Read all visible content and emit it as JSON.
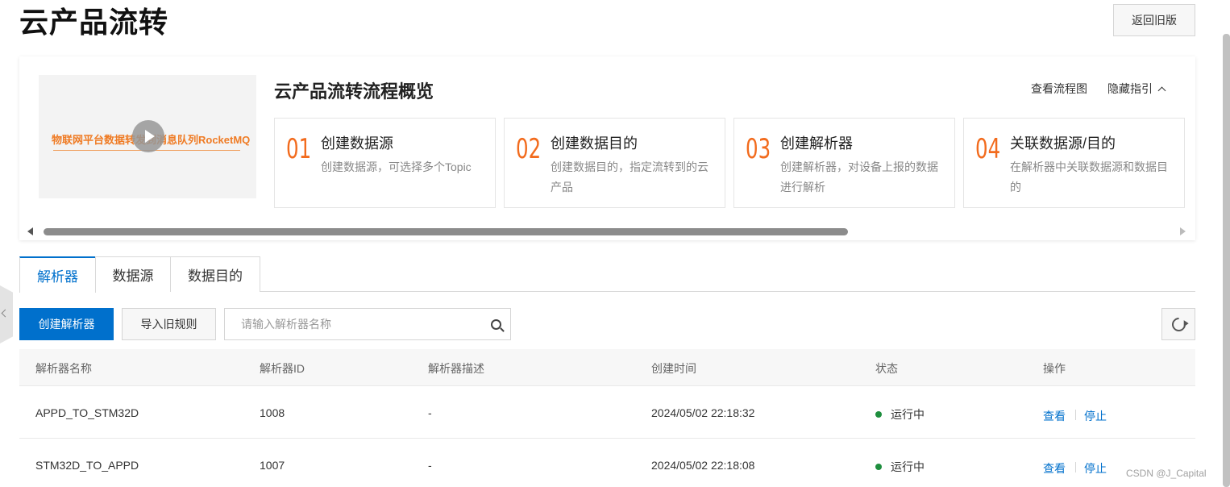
{
  "page": {
    "title": "云产品流转",
    "back_label": "返回旧版"
  },
  "guide": {
    "video_caption": "物联网平台数据转发到消息队列RocketMQ",
    "title": "云产品流转流程概览",
    "view_flow_label": "查看流程图",
    "hide_guide_label": "隐藏指引",
    "steps": [
      {
        "num": "01",
        "title": "创建数据源",
        "desc": "创建数据源，可选择多个Topic"
      },
      {
        "num": "02",
        "title": "创建数据目的",
        "desc": "创建数据目的，指定流转到的云产品"
      },
      {
        "num": "03",
        "title": "创建解析器",
        "desc": "创建解析器，对设备上报的数据进行解析"
      },
      {
        "num": "04",
        "title": "关联数据源/目的",
        "desc": "在解析器中关联数据源和数据目的"
      }
    ]
  },
  "tabs": [
    {
      "label": "解析器",
      "active": true
    },
    {
      "label": "数据源",
      "active": false
    },
    {
      "label": "数据目的",
      "active": false
    }
  ],
  "toolbar": {
    "create_label": "创建解析器",
    "import_label": "导入旧规则",
    "search_placeholder": "请输入解析器名称",
    "search_value": ""
  },
  "table": {
    "columns": [
      "解析器名称",
      "解析器ID",
      "解析器描述",
      "创建时间",
      "状态",
      "操作"
    ],
    "rows": [
      {
        "name": "APPD_TO_STM32D",
        "id": "1008",
        "desc": "-",
        "created": "2024/05/02 22:18:32",
        "status": "运行中",
        "view": "查看",
        "stop": "停止"
      },
      {
        "name": "STM32D_TO_APPD",
        "id": "1007",
        "desc": "-",
        "created": "2024/05/02 22:18:08",
        "status": "运行中",
        "view": "查看",
        "stop": "停止"
      }
    ]
  },
  "colors": {
    "accent": "#0070cc",
    "step_number": "#f26b1d",
    "status_running": "#1e8e3e"
  },
  "icons": [
    "play-icon",
    "chevron-up-icon",
    "search-icon",
    "refresh-icon",
    "chevron-left-icon",
    "status-dot-icon"
  ],
  "watermark": "CSDN @J_Capital"
}
